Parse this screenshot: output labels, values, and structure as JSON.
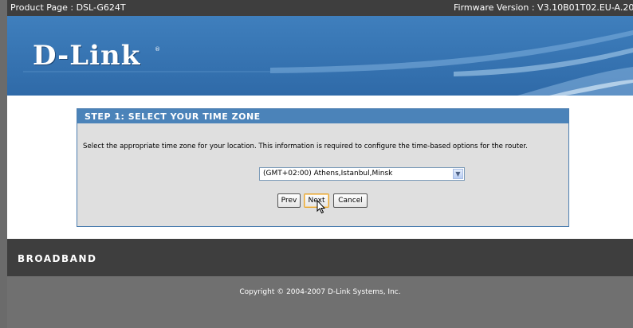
{
  "topbar": {
    "product": "Product Page : DSL-G624T",
    "firmware": "Firmware Version : V3.10B01T02.EU-A.20070924"
  },
  "brand": {
    "logo": "D-Link",
    "trademark": "®"
  },
  "wizard": {
    "title": "STEP 1: SELECT YOUR TIME ZONE",
    "description": "Select the appropriate time zone for your location. This information is required to configure the time-based options for the router.",
    "timezone_value": "(GMT+02:00) Athens,Istanbul,Minsk",
    "buttons": {
      "prev": "Prev",
      "next": "Next",
      "cancel": "Cancel"
    }
  },
  "broadband": {
    "label": "BROADBAND"
  },
  "footer": {
    "copyright": "Copyright © 2004-2007 D-Link Systems, Inc."
  },
  "colors": {
    "banner_blue": "#3f7fbd",
    "panel_header": "#4b83b9",
    "panel_bg": "#dfdfdf",
    "dark_bar": "#3e3e3e",
    "footer_gray": "#707070"
  },
  "icons": {
    "dropdown": "chevron-down-icon",
    "cursor": "mouse-pointer-icon"
  }
}
